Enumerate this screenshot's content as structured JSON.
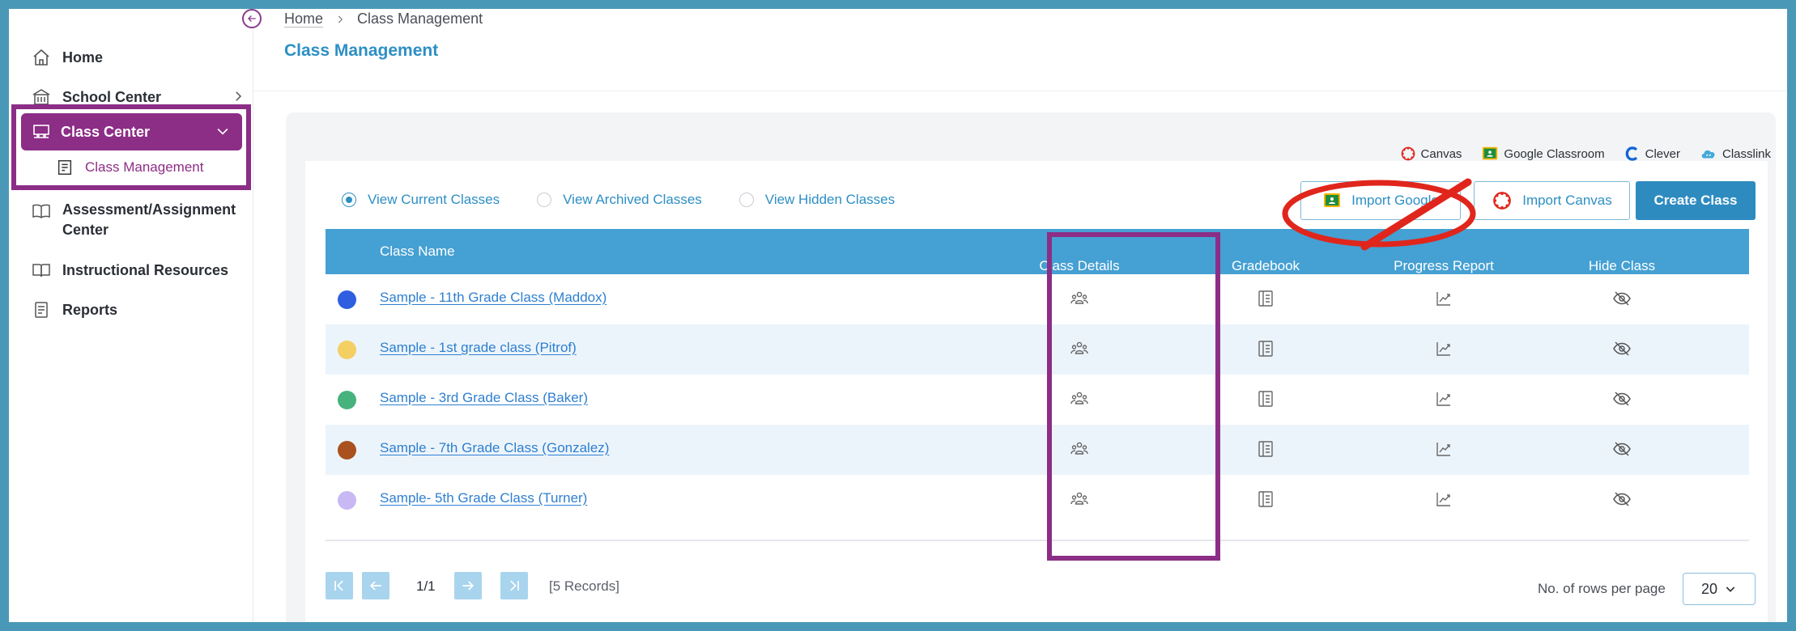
{
  "sidebar": {
    "items": [
      {
        "label": "Home",
        "icon": "home-icon"
      },
      {
        "label": "School Center",
        "icon": "school-icon"
      },
      {
        "label": "Class Center",
        "icon": "classroom-icon"
      },
      {
        "label": "Assessment/Assignment",
        "label2": "Center",
        "icon": "book-open-icon"
      },
      {
        "label": "Instructional Resources",
        "icon": "book-icon"
      },
      {
        "label": "Reports",
        "icon": "report-icon"
      }
    ],
    "sub_items": [
      {
        "label": "Class Management",
        "icon": "class-management-icon"
      }
    ]
  },
  "breadcrumb": {
    "home": "Home",
    "current": "Class Management"
  },
  "page_title": "Class Management",
  "integrations": [
    {
      "label": "Canvas",
      "icon": "canvas-icon"
    },
    {
      "label": "Google Classroom",
      "icon": "google-classroom-icon"
    },
    {
      "label": "Clever",
      "icon": "clever-icon"
    },
    {
      "label": "Classlink",
      "icon": "classlink-icon"
    }
  ],
  "view_options": [
    {
      "label": "View Current Classes",
      "selected": true
    },
    {
      "label": "View Archived Classes",
      "selected": false
    },
    {
      "label": "View Hidden Classes",
      "selected": false
    }
  ],
  "actions": {
    "import_google": "Import Google",
    "import_canvas": "Import Canvas",
    "create_class": "Create Class"
  },
  "table": {
    "columns": [
      "Class Name",
      "Class Details",
      "Gradebook",
      "Progress Report",
      "Hide Class"
    ],
    "rows": [
      {
        "name": "Sample - 11th Grade Class (Maddox)",
        "color": "#2f5fe0"
      },
      {
        "name": "Sample - 1st grade class (Pitrof)",
        "color": "#f4cf62"
      },
      {
        "name": "Sample - 3rd Grade Class (Baker)",
        "color": "#47b27c"
      },
      {
        "name": "Sample - 7th Grade Class (Gonzalez)",
        "color": "#a9521f"
      },
      {
        "name": "Sample- 5th Grade Class (Turner)",
        "color": "#c8b8f4"
      }
    ]
  },
  "pagination": {
    "page": "1/1",
    "records": "[5 Records]",
    "rows_label": "No. of rows per page",
    "rows_per_page": "20"
  },
  "colors": {
    "accent_purple": "#8c2d86",
    "primary_blue": "#2e8bc0",
    "annotation_red": "#e0261c"
  }
}
